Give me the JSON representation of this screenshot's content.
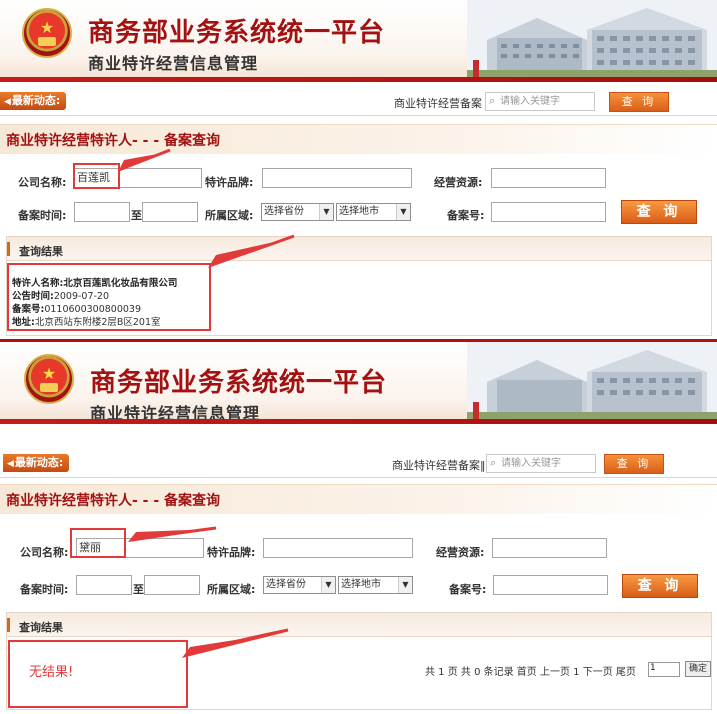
{
  "header": {
    "title": "商务部业务系统统一平台",
    "subtitle": "商业特许经营信息管理"
  },
  "nav": {
    "news_label": "最新动态:",
    "filing_label_top": "商业特许经营备案",
    "filing_label_bottom": "商业特许经营备案‖",
    "search_placeholder": "请输入关键字",
    "search_button": "查 询"
  },
  "page": {
    "section_title": "商业特许经营特许人- - - 备案查询"
  },
  "form": {
    "company_label": "公司名称:",
    "brand_label": "特许品牌:",
    "resource_label": "经营资源:",
    "date_label": "备案时间:",
    "to_label": "至",
    "region_label": "所属区域:",
    "province_select": "选择省份",
    "city_select": "选择地市",
    "record_no_label": "备案号:",
    "query_button": "查 询"
  },
  "search1": {
    "company_value": "百莲凯",
    "result_title": "查询结果",
    "result": {
      "franchiser_label": "特许人名称:",
      "franchiser_value": "北京百莲凯化妆品有限公司",
      "date_label": "公告时间:",
      "date_value": "2009-07-20",
      "record_label": "备案号:",
      "record_value": "0110600300800039",
      "address_label": "地址:",
      "address_value": "北京西站东附楼2层B区201室"
    }
  },
  "search2": {
    "company_value": "黛丽",
    "result_title": "查询结果",
    "no_result": "无结果!",
    "pager_text": "共 1 页 共 0 条记录 首页 上一页 1 下一页 尾页",
    "pager_input": "1",
    "pager_button": "确定"
  },
  "colors": {
    "brand_red": "#a31212",
    "accent_orange": "#e0701f",
    "annotation_red": "#e23a3a"
  }
}
